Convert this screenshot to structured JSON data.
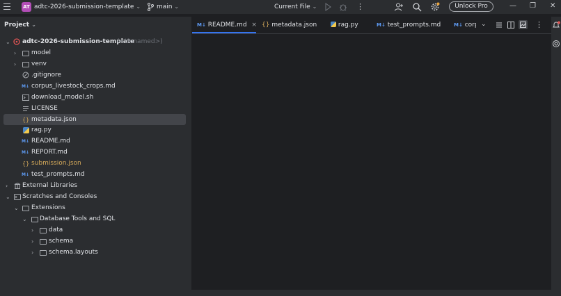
{
  "topbar": {
    "project_badge": "AT",
    "project_name": "adtc-2026-submission-template",
    "branch": "main",
    "run_config": "Current File",
    "unlock_label": "Unlock Pro",
    "icons": [
      "hamburger-icon",
      "branch-icon",
      "run-icon",
      "debug-icon",
      "more-icon",
      "add-user-icon",
      "search-icon",
      "settings-icon",
      "minimize-icon",
      "restore-icon",
      "close-icon"
    ]
  },
  "project_panel": {
    "title": "Project",
    "root": {
      "name": "adtc-2026-submission-template",
      "suffix": "(<Unnamed>)"
    },
    "items": [
      {
        "label": "model",
        "type": "folder"
      },
      {
        "label": "venv",
        "type": "folder"
      },
      {
        "label": ".gitignore",
        "type": "ignore"
      },
      {
        "label": "corpus_livestock_crops.md",
        "type": "md"
      },
      {
        "label": "download_model.sh",
        "type": "sh"
      },
      {
        "label": "LICENSE",
        "type": "text"
      },
      {
        "label": "metadata.json",
        "type": "json"
      },
      {
        "label": "rag.py",
        "type": "py"
      },
      {
        "label": "README.md",
        "type": "md"
      },
      {
        "label": "REPORT.md",
        "type": "md"
      },
      {
        "label": "submission.json",
        "type": "json"
      },
      {
        "label": "test_prompts.md",
        "type": "md"
      }
    ],
    "external_libraries": "External Libraries",
    "scratches": "Scratches and Consoles",
    "extensions": "Extensions",
    "db_tools": "Database Tools and SQL",
    "db_children": [
      "data",
      "schema",
      "schema.layouts"
    ]
  },
  "editor": {
    "tabs": [
      {
        "icon": "M↓",
        "label": "README.md",
        "active": true
      },
      {
        "icon": "{}",
        "label": "metadata.json"
      },
      {
        "icon": "py",
        "label": "rag.py"
      },
      {
        "icon": "M↓",
        "label": "test_prompts.md"
      },
      {
        "icon": "M↓",
        "label": "corp"
      }
    ],
    "tab_close": "×"
  },
  "colors": {
    "accent": "#3574f0",
    "bg": "#1e1f22",
    "panel": "#2b2d30",
    "selected": "#43454a",
    "orange": "#d4a95a"
  }
}
